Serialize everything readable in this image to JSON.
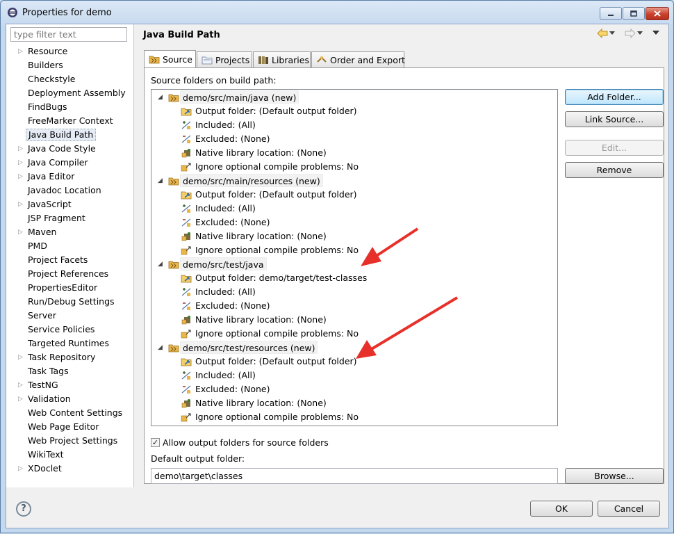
{
  "window": {
    "title": "Properties for demo",
    "controls": [
      "minimize",
      "maximize",
      "close"
    ]
  },
  "filter": {
    "placeholder": "type filter text"
  },
  "nav": {
    "items": [
      {
        "label": "Resource",
        "expandable": true
      },
      {
        "label": "Builders",
        "expandable": false
      },
      {
        "label": "Checkstyle",
        "expandable": false
      },
      {
        "label": "Deployment Assembly",
        "expandable": false
      },
      {
        "label": "FindBugs",
        "expandable": false
      },
      {
        "label": "FreeMarker Context",
        "expandable": false
      },
      {
        "label": "Java Build Path",
        "expandable": false,
        "selected": true
      },
      {
        "label": "Java Code Style",
        "expandable": true
      },
      {
        "label": "Java Compiler",
        "expandable": true
      },
      {
        "label": "Java Editor",
        "expandable": true
      },
      {
        "label": "Javadoc Location",
        "expandable": false
      },
      {
        "label": "JavaScript",
        "expandable": true
      },
      {
        "label": "JSP Fragment",
        "expandable": false
      },
      {
        "label": "Maven",
        "expandable": true
      },
      {
        "label": "PMD",
        "expandable": false
      },
      {
        "label": "Project Facets",
        "expandable": false
      },
      {
        "label": "Project References",
        "expandable": false
      },
      {
        "label": "PropertiesEditor",
        "expandable": false
      },
      {
        "label": "Run/Debug Settings",
        "expandable": false
      },
      {
        "label": "Server",
        "expandable": false
      },
      {
        "label": "Service Policies",
        "expandable": false
      },
      {
        "label": "Targeted Runtimes",
        "expandable": false
      },
      {
        "label": "Task Repository",
        "expandable": true
      },
      {
        "label": "Task Tags",
        "expandable": false
      },
      {
        "label": "TestNG",
        "expandable": true
      },
      {
        "label": "Validation",
        "expandable": true
      },
      {
        "label": "Web Content Settings",
        "expandable": false
      },
      {
        "label": "Web Page Editor",
        "expandable": false
      },
      {
        "label": "Web Project Settings",
        "expandable": false
      },
      {
        "label": "WikiText",
        "expandable": false
      },
      {
        "label": "XDoclet",
        "expandable": true
      }
    ]
  },
  "page": {
    "title": "Java Build Path"
  },
  "tabs": [
    {
      "label": "Source",
      "active": true
    },
    {
      "label": "Projects",
      "active": false
    },
    {
      "label": "Libraries",
      "active": false
    },
    {
      "label": "Order and Export",
      "active": false
    }
  ],
  "source": {
    "label": "Source folders on build path:",
    "folders": [
      {
        "name": "demo/src/main/java (new)",
        "children": [
          {
            "kind": "output",
            "text": "Output folder: (Default output folder)"
          },
          {
            "kind": "included",
            "text": "Included: (All)"
          },
          {
            "kind": "excluded",
            "text": "Excluded: (None)"
          },
          {
            "kind": "native",
            "text": "Native library location: (None)"
          },
          {
            "kind": "ignore",
            "text": "Ignore optional compile problems: No"
          }
        ]
      },
      {
        "name": "demo/src/main/resources (new)",
        "children": [
          {
            "kind": "output",
            "text": "Output folder: (Default output folder)"
          },
          {
            "kind": "included",
            "text": "Included: (All)"
          },
          {
            "kind": "excluded",
            "text": "Excluded: (None)"
          },
          {
            "kind": "native",
            "text": "Native library location: (None)"
          },
          {
            "kind": "ignore",
            "text": "Ignore optional compile problems: No"
          }
        ]
      },
      {
        "name": "demo/src/test/java",
        "children": [
          {
            "kind": "output",
            "text": "Output folder: demo/target/test-classes"
          },
          {
            "kind": "included",
            "text": "Included: (All)"
          },
          {
            "kind": "excluded",
            "text": "Excluded: (None)"
          },
          {
            "kind": "native",
            "text": "Native library location: (None)"
          },
          {
            "kind": "ignore",
            "text": "Ignore optional compile problems: No"
          }
        ]
      },
      {
        "name": "demo/src/test/resources (new)",
        "children": [
          {
            "kind": "output",
            "text": "Output folder: (Default output folder)"
          },
          {
            "kind": "included",
            "text": "Included: (All)"
          },
          {
            "kind": "excluded",
            "text": "Excluded: (None)"
          },
          {
            "kind": "native",
            "text": "Native library location: (None)"
          },
          {
            "kind": "ignore",
            "text": "Ignore optional compile problems: No"
          }
        ]
      }
    ]
  },
  "buttons": {
    "add_folder": "Add Folder...",
    "link_source": "Link Source...",
    "edit": "Edit...",
    "remove": "Remove",
    "browse": "Browse...",
    "ok": "OK",
    "cancel": "Cancel"
  },
  "options": {
    "allow_output_label": "Allow output folders for source folders",
    "allow_output_checked": true,
    "default_output_label": "Default output folder:",
    "default_output_value": "demo\\target\\classes"
  },
  "help": {
    "glyph": "?"
  },
  "colors": {
    "annotation_arrow": "#e8302a",
    "selection": "#e5ecf5",
    "folder": "#e8b64a"
  }
}
